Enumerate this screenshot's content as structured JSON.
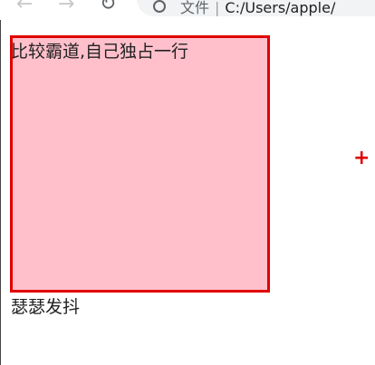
{
  "browser": {
    "back_icon": "←",
    "forward_icon": "→",
    "reload_icon": "↻",
    "security_label": "文件",
    "separator": "|",
    "url": "C:/Users/apple/"
  },
  "page": {
    "box_text": "比较霸道,自己独占一行",
    "below_text": "瑟瑟发抖",
    "plus_mark": "+"
  }
}
